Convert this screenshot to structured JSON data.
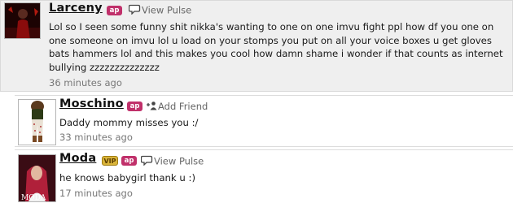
{
  "posts": [
    {
      "username": "Larceny",
      "badge": "ap",
      "action": "View Pulse",
      "action_icon": "speech-bubble-icon",
      "text": "Lol so I seen some funny shit nikka's wanting to one on one imvu fight ppl how df you one on one someone on imvu lol u load on your stomps you put on all your voice boxes u get gloves bats hammers lol and this makes you cool how damn shame i wonder if that counts as internet bullying zzzzzzzzzzzzzz",
      "time": "36 minutes ago"
    },
    {
      "username": "Moschino",
      "badge": "ap",
      "action": "Add Friend",
      "action_icon": "add-friend-icon",
      "text": "Daddy mommy misses you :/",
      "time": "33 minutes ago"
    },
    {
      "username": "Moda",
      "badge": "ap",
      "vip": "VIP",
      "action": "View Pulse",
      "action_icon": "speech-bubble-icon",
      "text": "he knows babygirl thank u :)",
      "time": "17 minutes ago"
    }
  ],
  "colors": {
    "ap_badge": "#c0306a",
    "vip_badge": "#d9b43a",
    "main_bg": "#efefef"
  }
}
